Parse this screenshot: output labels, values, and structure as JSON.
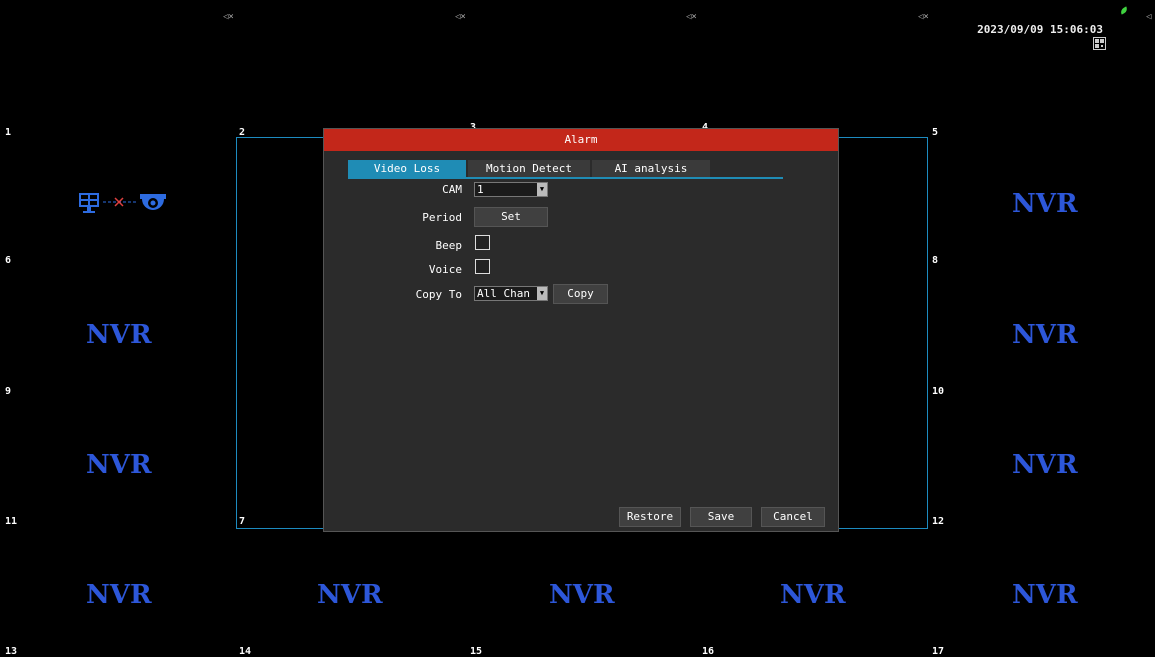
{
  "status": {
    "datetime": "2023/09/09 15:06:03"
  },
  "grid": {
    "watermark": "NVR",
    "channels": [
      "1",
      "2",
      "3",
      "4",
      "5",
      "6",
      "7",
      "8",
      "9",
      "10",
      "11",
      "12",
      "13",
      "14",
      "15",
      "16",
      "17"
    ]
  },
  "dialog": {
    "title": "Alarm",
    "tabs": [
      {
        "label": "Video Loss",
        "active": true
      },
      {
        "label": "Motion Detect",
        "active": false
      },
      {
        "label": "AI analysis",
        "active": false
      }
    ],
    "fields": {
      "cam_label": "CAM",
      "cam_value": "1",
      "period_label": "Period",
      "period_button": "Set",
      "beep_label": "Beep",
      "beep_checked": false,
      "voice_label": "Voice",
      "voice_checked": false,
      "copy_to_label": "Copy To",
      "copy_to_value": "All Chan",
      "copy_button": "Copy"
    },
    "buttons": {
      "restore": "Restore",
      "save": "Save",
      "cancel": "Cancel"
    }
  },
  "colors": {
    "title_bar": "#c3271a",
    "accent": "#1f8cb5",
    "nvr_text": "#2d57d9",
    "no_link_x": "#e04040",
    "icon_blue": "#2d6be0"
  },
  "icons": [
    "speaker-mute-icon",
    "monitor-icon",
    "camera-dome-icon",
    "leaf-icon",
    "qr-code-icon",
    "dropdown-arrow-icon"
  ]
}
